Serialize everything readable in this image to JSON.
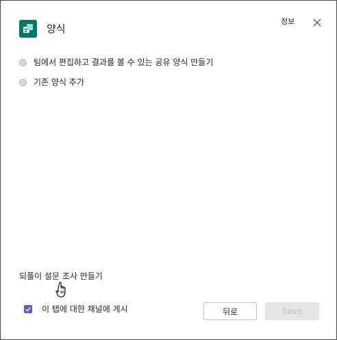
{
  "dialog": {
    "title": "양식",
    "about_label": "정보",
    "close_icon": "close-icon",
    "app_icon": "forms-app-icon",
    "app_icon_color": "#077568"
  },
  "options": [
    {
      "label": "팀에서 편집하고 결과를 볼 수 있는 공유 양식 만들기",
      "selected": false
    },
    {
      "label": "기존 양식 추가",
      "selected": false
    }
  ],
  "quick_poll_label": "되풀이 설문 조사 만들기",
  "post_to_channel": {
    "label": "이 탭에 대한 채널에 게시",
    "checked": true
  },
  "buttons": {
    "back_label": "뒤로",
    "save_label": "Save",
    "save_disabled": true
  },
  "colors": {
    "accent": "#5b5fc7",
    "forms_teal": "#077568",
    "disabled_button_bg": "#e6e6e6"
  }
}
